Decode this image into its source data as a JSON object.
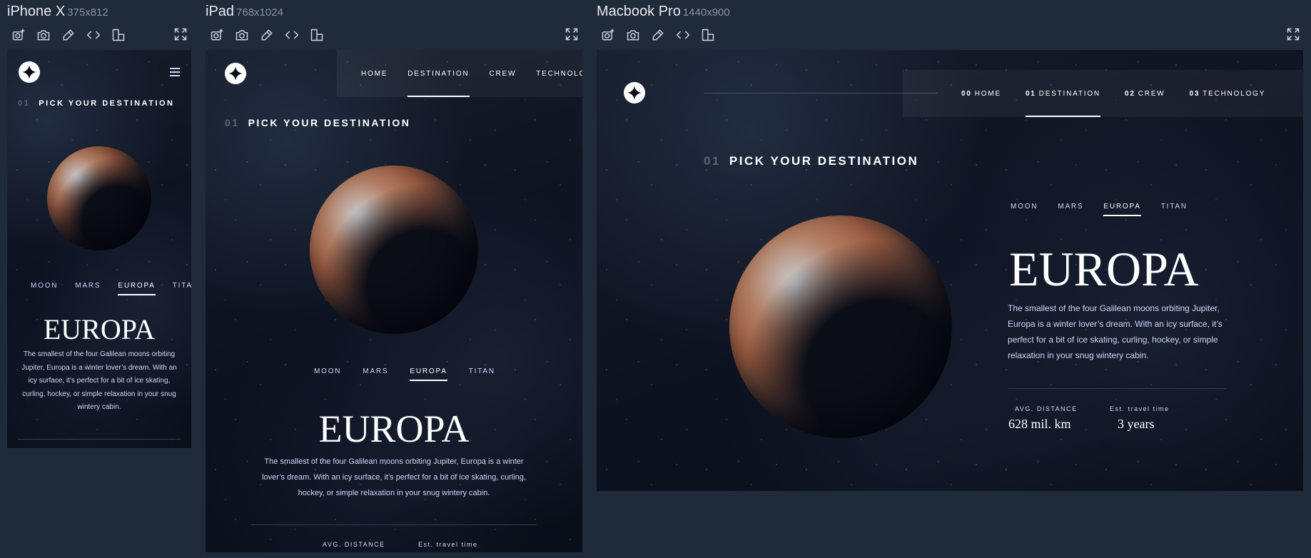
{
  "devices": {
    "iphone": {
      "name": "iPhone X",
      "dims": "375x812"
    },
    "ipad": {
      "name": "iPad",
      "dims": "768x1024"
    },
    "macbook": {
      "name": "Macbook Pro",
      "dims": "1440x900"
    }
  },
  "toolbar_icons": [
    "camera-plus-icon",
    "camera-icon",
    "eyedropper-icon",
    "code-icon",
    "rotate-device-icon"
  ],
  "site": {
    "pick_num": "01",
    "pick_text": "PICK YOUR DESTINATION",
    "nav": {
      "home": "HOME",
      "destination": "DESTINATION",
      "crew": "CREW",
      "technology": "TECHNOLOGY",
      "home_num": "00",
      "destination_num": "01",
      "crew_num": "02",
      "technology_num": "03"
    },
    "tabs": [
      "MOON",
      "MARS",
      "EUROPA",
      "TITAN"
    ],
    "active_tab": "EUROPA",
    "planet_name": "EUROPA",
    "description": "The smallest of the four Galilean moons orbiting Jupiter, Europa is a winter lover’s dream. With an icy surface, it’s perfect for a bit of ice skating, curling, hockey, or simple relaxation in your snug wintery cabin.",
    "distance_label": "AVG. DISTANCE",
    "distance_value": "628 mil. km",
    "travel_label": "Est. travel time",
    "travel_value": "3 years"
  },
  "colors": {
    "bg": "#1f2a3b",
    "space": "#0b0d17",
    "accent_text": "#d0d6f9"
  }
}
